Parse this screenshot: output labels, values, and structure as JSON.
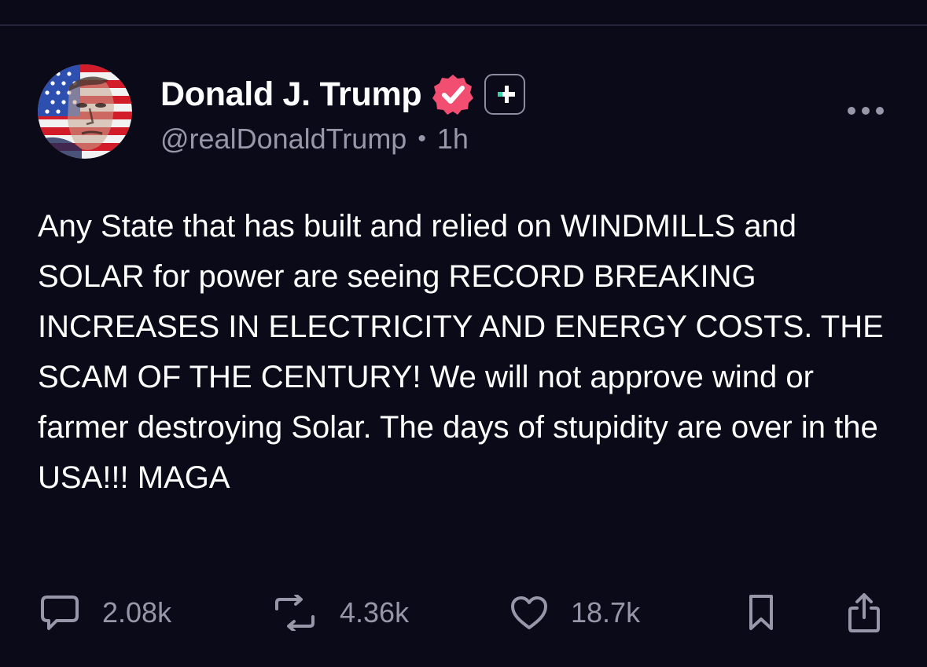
{
  "post": {
    "author": {
      "display_name": "Donald J. Trump",
      "handle": "@realDonaldTrump",
      "verified": true,
      "plus_badge": true
    },
    "separator": "•",
    "timestamp": "1h",
    "text": "Any State that has built and relied on WINDMILLS and SOLAR for power are seeing RECORD BREAKING INCREASES IN ELECTRICITY AND ENERGY COSTS. THE SCAM OF THE CENTURY! We will not approve wind or farmer destroying Solar. The days of stupidity are over in the USA!!! MAGA",
    "actions": {
      "replies": "2.08k",
      "reposts": "4.36k",
      "likes": "18.7k"
    }
  },
  "icons": {
    "reply": "speech-bubble-icon",
    "repost": "repost-arrows-icon",
    "like": "heart-icon",
    "bookmark": "bookmark-icon",
    "share": "share-icon",
    "more": "ellipsis-icon",
    "verified": "verified-check-icon",
    "plus": "plus-badge-icon"
  },
  "colors": {
    "background": "#0b0a19",
    "text_primary": "#ffffff",
    "text_secondary": "#9896a9",
    "verified_badge": "#f24e71",
    "plus_accent": "#3ed2a8",
    "divider": "#23223a"
  }
}
